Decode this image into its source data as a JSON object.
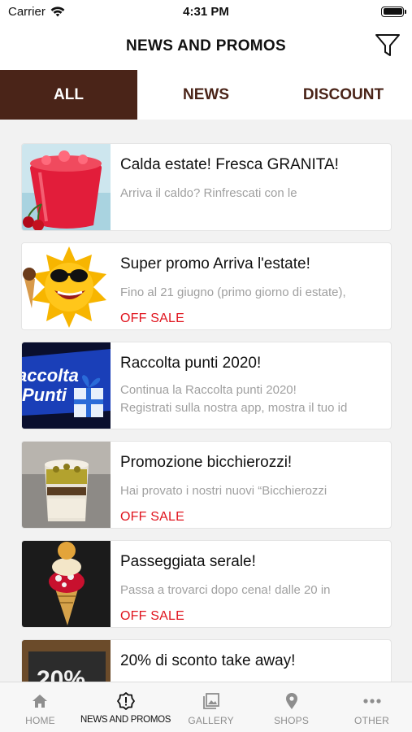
{
  "status": {
    "carrier": "Carrier",
    "time": "4:31 PM"
  },
  "header": {
    "title": "NEWS AND PROMOS"
  },
  "tabs": [
    {
      "label": "ALL",
      "active": true
    },
    {
      "label": "NEWS",
      "active": false
    },
    {
      "label": "DISCOUNT",
      "active": false
    }
  ],
  "cards": [
    {
      "title": "Calda estate! Fresca GRANITA!",
      "description": "Arriva il caldo? Rinfrescati con le",
      "badge": ""
    },
    {
      "title": "Super promo Arriva l'estate!",
      "description": "Fino al 21 giugno (primo giorno di estate),",
      "badge": "OFF SALE"
    },
    {
      "title": "Raccolta punti 2020!",
      "description": "Continua  la Raccolta punti 2020!",
      "description2": "Registrati sulla nostra app, mostra il tuo id",
      "badge": "",
      "image_text": [
        "accolta",
        "Punti"
      ]
    },
    {
      "title": "Promozione bicchierozzi!",
      "description": "Hai provato i nostri nuovi “Bicchierozzi",
      "badge": "OFF SALE"
    },
    {
      "title": "Passeggiata serale!",
      "description": "Passa a trovarci dopo cena! dalle 20 in",
      "badge": "OFF SALE"
    },
    {
      "title": "20% di sconto take away!",
      "description": "",
      "badge": "",
      "image_text": "20%"
    }
  ],
  "bottom_tabs": [
    {
      "label": "HOME",
      "icon": "home-icon",
      "active": false
    },
    {
      "label": "NEWS AND PROMOS",
      "icon": "alert-badge-icon",
      "active": true
    },
    {
      "label": "GALLERY",
      "icon": "gallery-icon",
      "active": false
    },
    {
      "label": "SHOPS",
      "icon": "map-pin-icon",
      "active": false
    },
    {
      "label": "OTHER",
      "icon": "more-icon",
      "active": false
    }
  ],
  "colors": {
    "accent": "#4a2418",
    "sale": "#e0141e",
    "muted": "#a0a0a0"
  }
}
